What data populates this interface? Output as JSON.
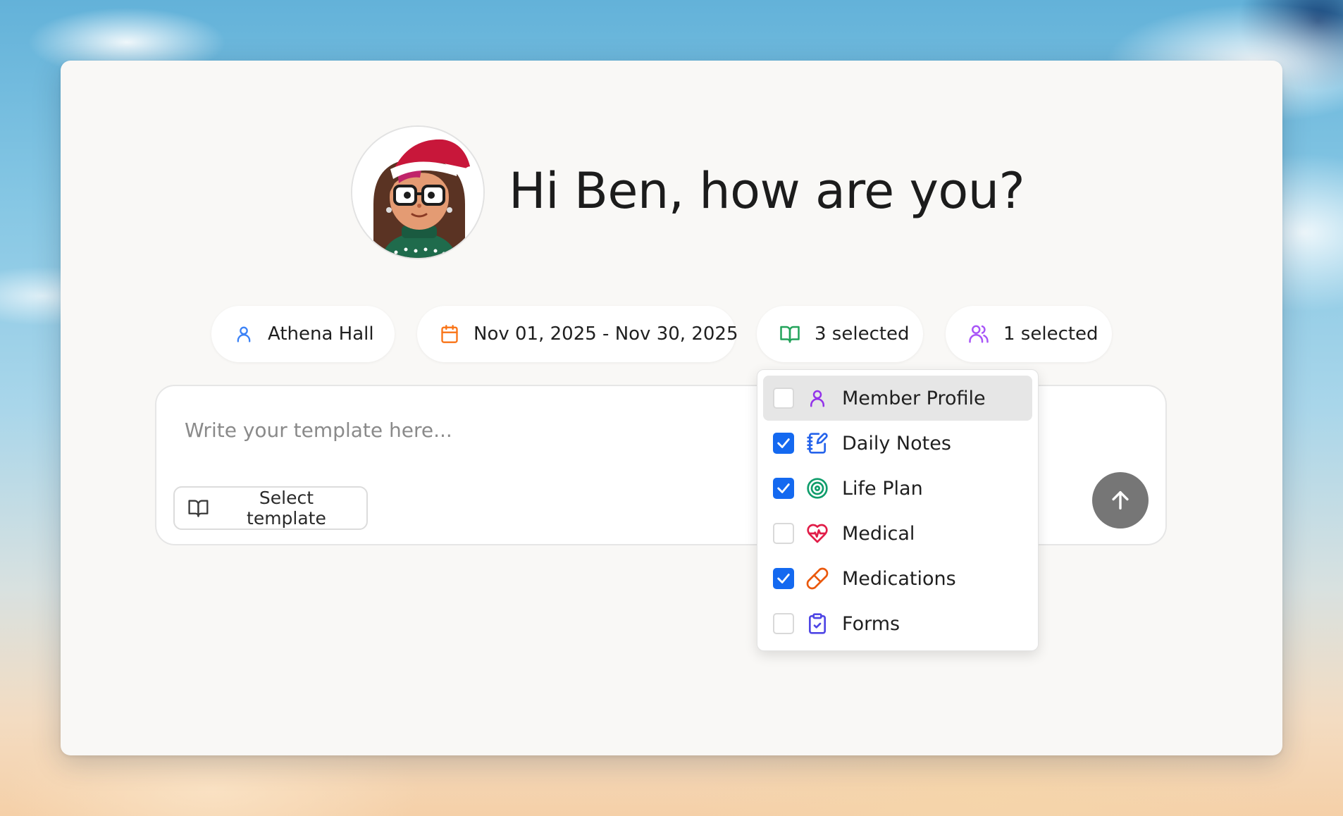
{
  "greeting": "Hi Ben, how are you?",
  "avatar": {
    "name": "santa-hat-avatar"
  },
  "filters": {
    "user": {
      "label": "Athena Hall",
      "icon": "user-icon",
      "color": "#3b82f6"
    },
    "date_range": {
      "label": "Nov 01, 2025 - Nov 30, 2025",
      "icon": "calendar-icon",
      "color": "#f97316"
    },
    "sources": {
      "label": "3 selected",
      "icon": "book-open-icon",
      "color": "#22a35a"
    },
    "members": {
      "label": "1 selected",
      "icon": "users-icon",
      "color": "#a855f7"
    }
  },
  "composer": {
    "placeholder": "Write your template here...",
    "select_template_label": "Select template",
    "send_icon": "arrow-up-icon"
  },
  "sources_dropdown": {
    "items": [
      {
        "label": "Member Profile",
        "checked": false,
        "icon": "user-icon",
        "color": "#9333ea",
        "highlighted": true
      },
      {
        "label": "Daily Notes",
        "checked": true,
        "icon": "notebook-pen-icon",
        "color": "#2563eb"
      },
      {
        "label": "Life Plan",
        "checked": true,
        "icon": "target-icon",
        "color": "#0f9d6b"
      },
      {
        "label": "Medical",
        "checked": false,
        "icon": "heart-pulse-icon",
        "color": "#e11d48"
      },
      {
        "label": "Medications",
        "checked": true,
        "icon": "pill-icon",
        "color": "#ea580c"
      },
      {
        "label": "Forms",
        "checked": false,
        "icon": "clipboard-check-icon",
        "color": "#4f46e5"
      }
    ]
  },
  "colors": {
    "checkbox_checked": "#1469f0",
    "send_button": "#767676",
    "card_background": "#f9f8f6"
  }
}
